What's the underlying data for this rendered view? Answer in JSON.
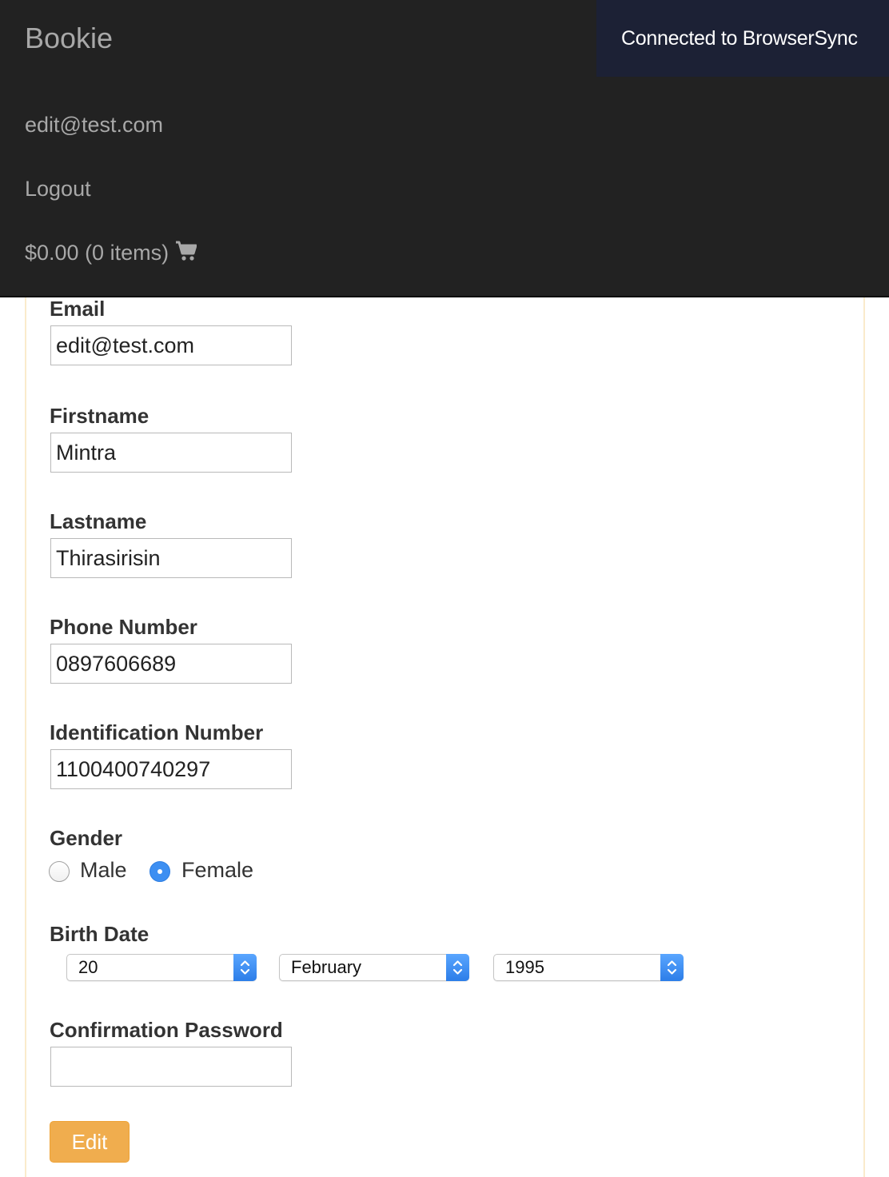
{
  "navbar": {
    "brand": "Bookie",
    "user_email": "edit@test.com",
    "logout_label": "Logout",
    "cart_label": "$0.00 (0 items)",
    "cart_icon": "shopping-cart-icon"
  },
  "browsersync": {
    "message": "Connected to BrowserSync"
  },
  "form": {
    "email": {
      "label": "Email",
      "value": "edit@test.com"
    },
    "firstname": {
      "label": "Firstname",
      "value": "Mintra"
    },
    "lastname": {
      "label": "Lastname",
      "value": "Thirasirisin"
    },
    "phone": {
      "label": "Phone Number",
      "value": "0897606689"
    },
    "identification": {
      "label": "Identification Number",
      "value": "1100400740297"
    },
    "gender": {
      "label": "Gender",
      "options": [
        "Male",
        "Female"
      ],
      "selected": "Female"
    },
    "birth_date": {
      "label": "Birth Date",
      "day": "20",
      "month": "February",
      "year": "1995"
    },
    "confirmation_password": {
      "label": "Confirmation Password",
      "value": ""
    },
    "submit_label": "Edit"
  },
  "colors": {
    "navbar_bg": "#222222",
    "panel_border": "#faebcc",
    "button_warning": "#f0ad4e",
    "radio_selected": "#3d8ff2"
  }
}
